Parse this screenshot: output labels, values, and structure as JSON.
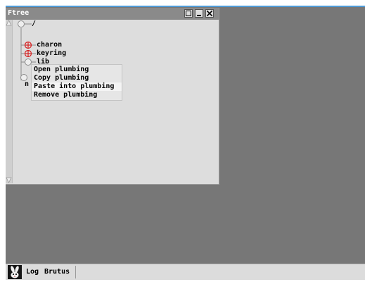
{
  "window": {
    "title": "Ftree"
  },
  "tree": {
    "root": "/",
    "items": [
      {
        "label": "charon",
        "state": "expanded-red"
      },
      {
        "label": "keyring",
        "state": "expanded-red"
      },
      {
        "label": "lib",
        "state": "collapsed"
      }
    ],
    "partial_labels": [
      "n"
    ]
  },
  "context_menu": {
    "items": [
      {
        "label": "Open plumbing"
      },
      {
        "label": "Copy plumbing"
      },
      {
        "label": "Paste into plumbing"
      },
      {
        "label": "Remove plumbing"
      }
    ],
    "highlighted_index": 2
  },
  "taskbar": {
    "items": [
      {
        "label": "Log"
      },
      {
        "label": "Brutus"
      }
    ]
  },
  "colors": {
    "desktop": "#777777",
    "titlebar": "#8a8a8a",
    "window_bg": "#dddddd",
    "node_red": "#d62020",
    "accent": "#4f9ad6"
  }
}
